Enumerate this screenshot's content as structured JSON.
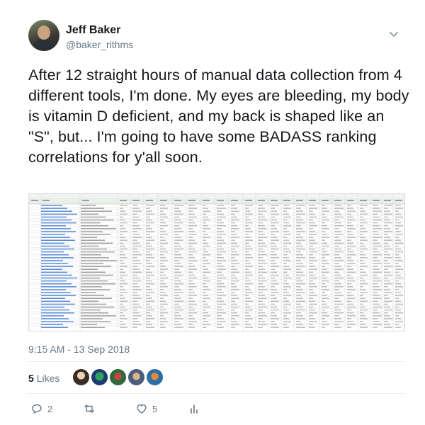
{
  "author": {
    "name": "Jeff Baker",
    "handle": "@baker_rithms"
  },
  "tweet_text": "After 12 straight hours of manual data collection from 4 different tools, I'm done. My eyes are bleeding, my body is vitamin D deficient, and my back is shaped like an \"S\", but... I'm going to have some BADASS ranking correlations for y'all soon.",
  "timestamp": "9:15 AM - 13 Sep 2018",
  "likes": {
    "count": "5",
    "label": "Likes"
  },
  "actions": {
    "replies": "2",
    "retweets": "",
    "likes": "5"
  },
  "icons": [
    "chevron-down-icon",
    "reply-icon",
    "retweet-icon",
    "heart-icon",
    "analytics-icon"
  ],
  "colors": {
    "link_blue": "#2266cc",
    "muted": "#657786",
    "sheet_header": "#e9efe9"
  }
}
